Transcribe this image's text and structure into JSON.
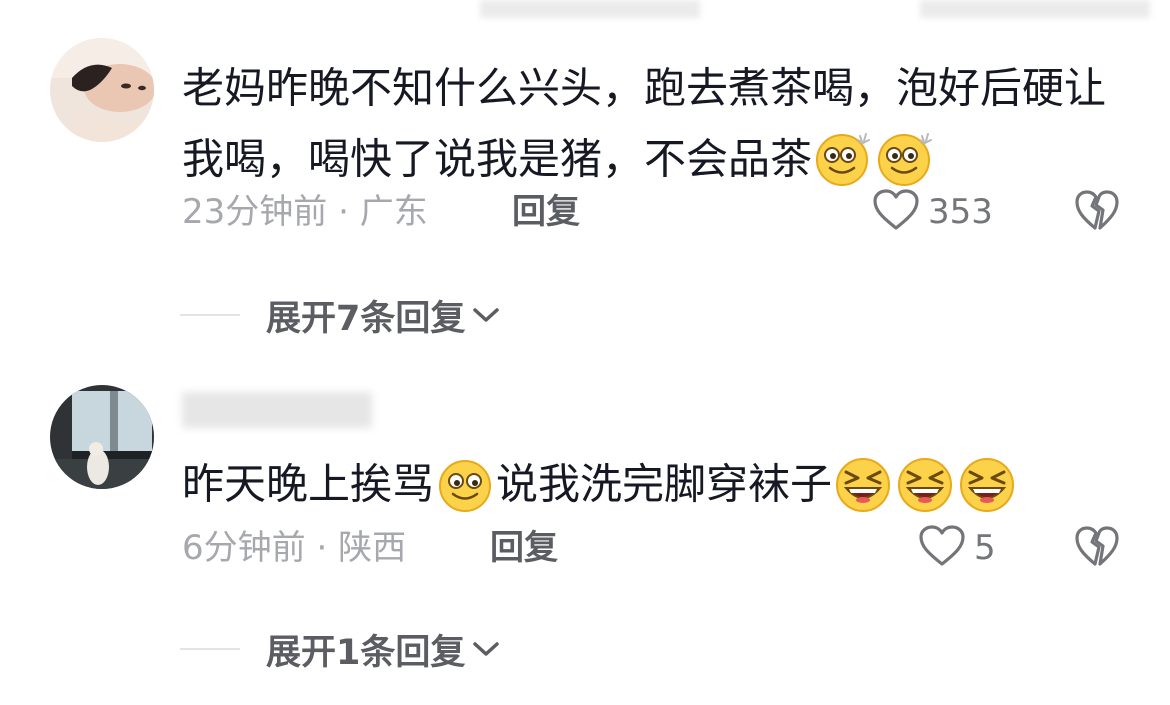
{
  "comments": [
    {
      "text_parts": [
        {
          "type": "text",
          "value": "老妈昨晚不知什么兴头，跑去煮茶喝，泡好后硬让我喝，喝快了说我是猪，不会品茶"
        },
        {
          "type": "emoji",
          "icon": "dizzy-smile-emoji"
        },
        {
          "type": "emoji",
          "icon": "dizzy-smile-emoji"
        }
      ],
      "time": "23分钟前",
      "separator": "·",
      "location": "广东",
      "reply_label": "回复",
      "like_count": "353",
      "expand_label": "展开7条回复"
    },
    {
      "text_parts": [
        {
          "type": "text",
          "value": "昨天晚上挨骂"
        },
        {
          "type": "emoji",
          "icon": "smile-emoji"
        },
        {
          "type": "text",
          "value": "说我洗完脚穿袜子"
        },
        {
          "type": "emoji",
          "icon": "laughing-squint-emoji"
        },
        {
          "type": "emoji",
          "icon": "laughing-squint-emoji"
        },
        {
          "type": "emoji",
          "icon": "laughing-squint-emoji"
        }
      ],
      "time": "6分钟前",
      "separator": "·",
      "location": "陕西",
      "reply_label": "回复",
      "like_count": "5",
      "expand_label": "展开1条回复"
    }
  ],
  "colors": {
    "text": "#161823",
    "meta": "#a6a8ad",
    "action": "#5b5d63",
    "icon": "#73757a",
    "emoji_fill": "#fcd24a"
  }
}
